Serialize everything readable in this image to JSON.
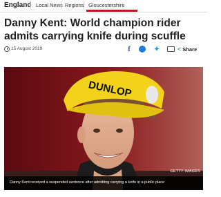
{
  "nav": {
    "section": "England",
    "items": [
      "Local News",
      "Regions",
      "Gloucestershire"
    ],
    "active_color": "#bb1919"
  },
  "article": {
    "headline": "Danny Kent: World champion rider admits carrying knife during scuffle",
    "date": "15 August 2019"
  },
  "share": {
    "icons": [
      "facebook-icon",
      "messenger-icon",
      "twitter-icon",
      "email-icon"
    ],
    "label": "Share"
  },
  "image": {
    "credit": "GETTY IMAGES",
    "caption": "Danny Kent received a suspended sentence after admitting carrying a knife in a public place",
    "cap_logo_text": "DUNLOP"
  }
}
